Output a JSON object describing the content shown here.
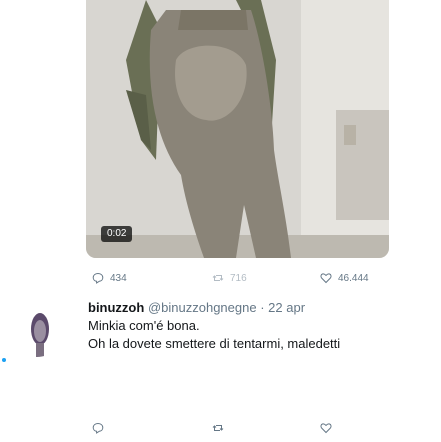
{
  "tweet1": {
    "video": {
      "duration": "0:02"
    },
    "actions": {
      "reply_count": "434",
      "retweet_count": "716",
      "like_count": "46.444"
    }
  },
  "tweet2": {
    "display_name": "binuzzoh",
    "handle": "@binuzzohgnegne",
    "separator": "·",
    "date": "22 apr",
    "lines": [
      "Minkia com'é bona.",
      "Oh la dovete smettere di tentarmi, maledetti"
    ]
  },
  "icons": {
    "reply": "reply-icon",
    "retweet": "retweet-icon",
    "like": "like-icon"
  },
  "colors": {
    "meta_text": "#657786",
    "retweet_disabled": "#b3bcc4",
    "accent": "#1da1f2"
  }
}
